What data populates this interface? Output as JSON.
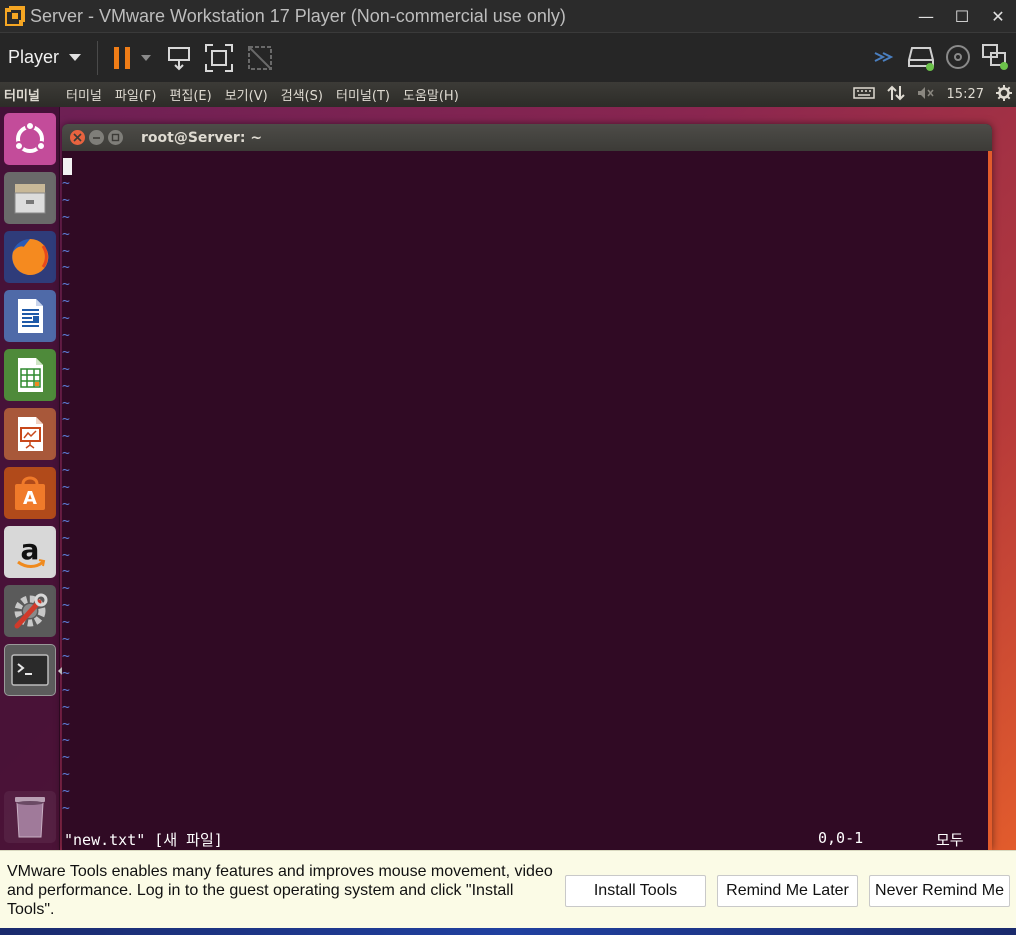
{
  "window": {
    "title": "Server - VMware Workstation 17 Player (Non-commercial use only)",
    "controls": {
      "minimize": "—",
      "maximize": "☐",
      "close": "✕"
    }
  },
  "toolbar": {
    "player_label": "Player",
    "icons": [
      "pause-icon",
      "send-ctrl-alt-del-icon",
      "fullscreen-icon",
      "unity-icon",
      "network-arrows-icon",
      "hard-disk-icon",
      "cd-icon",
      "network-adapter-icon"
    ],
    "accent": "#f07d17"
  },
  "ubuntu_panel": {
    "app_name": "터미널",
    "menus": [
      "터미널",
      "파일(F)",
      "편집(E)",
      "보기(V)",
      "검색(S)",
      "터미널(T)",
      "도움말(H)"
    ],
    "clock": "15:27",
    "icons": [
      "keyboard-icon",
      "network-updown-icon",
      "volume-muted-icon",
      "settings-gear-icon"
    ]
  },
  "launcher": {
    "items": [
      {
        "name": "ubuntu-dash-icon"
      },
      {
        "name": "files-icon"
      },
      {
        "name": "firefox-icon"
      },
      {
        "name": "libreoffice-writer-icon"
      },
      {
        "name": "libreoffice-calc-icon"
      },
      {
        "name": "libreoffice-impress-icon"
      },
      {
        "name": "software-center-icon"
      },
      {
        "name": "amazon-icon"
      },
      {
        "name": "system-settings-icon"
      },
      {
        "name": "terminal-icon"
      },
      {
        "name": "trash-icon"
      }
    ]
  },
  "terminal": {
    "title": "root@Server: ~",
    "empty_line_marker": "~",
    "status_file": "\"new.txt\" [새 파일]",
    "status_position": "0,0-1",
    "status_all": "모두",
    "colors": {
      "background": "#300a24",
      "tilde": "#5e7fdb"
    }
  },
  "tools_bar": {
    "message": "VMware Tools enables many features and improves mouse movement, video and performance. Log in to the guest operating system and click \"Install Tools\".",
    "install_label": "Install Tools",
    "remind_later_label": "Remind Me Later",
    "never_remind_label": "Never Remind Me"
  }
}
